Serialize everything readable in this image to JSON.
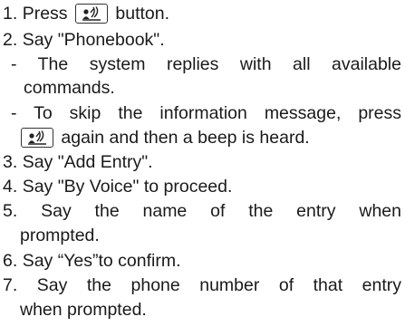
{
  "steps": [
    {
      "num": "1.",
      "pre": "Press",
      "post": "button."
    },
    {
      "num": "2.",
      "text": "Say \"Phonebook\"."
    },
    {
      "dash": "-",
      "text": "The system replies with all available"
    },
    {
      "text": "commands."
    },
    {
      "dash": "-",
      "text": "To skip the information message, press"
    },
    {
      "post": "again and then a beep is heard."
    },
    {
      "num": "3.",
      "text": "Say \"Add Entry\"."
    },
    {
      "num": "4.",
      "text": "Say \"By Voice\" to proceed."
    },
    {
      "num": "5.",
      "text": "Say the name of the entry when"
    },
    {
      "text": "prompted."
    },
    {
      "num": "6.",
      "text": "Say “Yes”to confirm."
    },
    {
      "num": "7.",
      "text": "Say the phone number of that entry"
    },
    {
      "text": "when prompted."
    }
  ],
  "icon": "voice-talk-icon"
}
